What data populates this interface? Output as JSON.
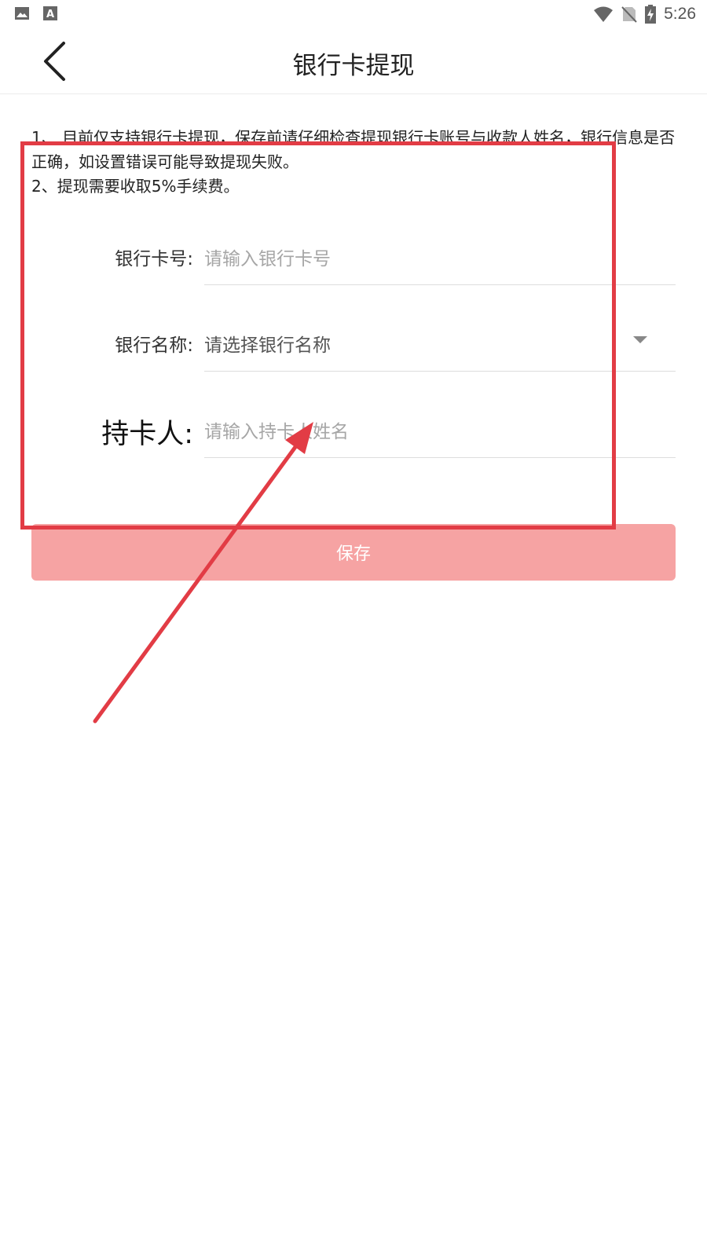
{
  "status_bar": {
    "time": "5:26",
    "left_icons": [
      "image-icon",
      "font-a-icon"
    ],
    "right_icons": [
      "wifi-icon",
      "no-sim-icon",
      "battery-charging-icon"
    ]
  },
  "header": {
    "title": "银行卡提现",
    "back_icon": "chevron-left-icon"
  },
  "notice": {
    "lines": [
      "1、 目前仅支持银行卡提现，保存前请仔细检查提现银行卡账号与收款人姓名，银行信息是否正确，如设置错误可能导致提现失败。",
      "2、提现需要收取5%手续费。"
    ]
  },
  "form": {
    "card_number": {
      "label": "银行卡号:",
      "value": "",
      "placeholder": "请输入银行卡号"
    },
    "bank_name": {
      "label": "银行名称:",
      "selected": "请选择银行名称"
    },
    "holder": {
      "label": "持卡人:",
      "value": "",
      "placeholder": "请输入持卡人姓名"
    }
  },
  "save_button": {
    "label": "保存"
  },
  "annotation": {
    "color": "#e23c45"
  },
  "colors": {
    "button_bg": "#f6a3a3",
    "accent": "#e23c45"
  }
}
